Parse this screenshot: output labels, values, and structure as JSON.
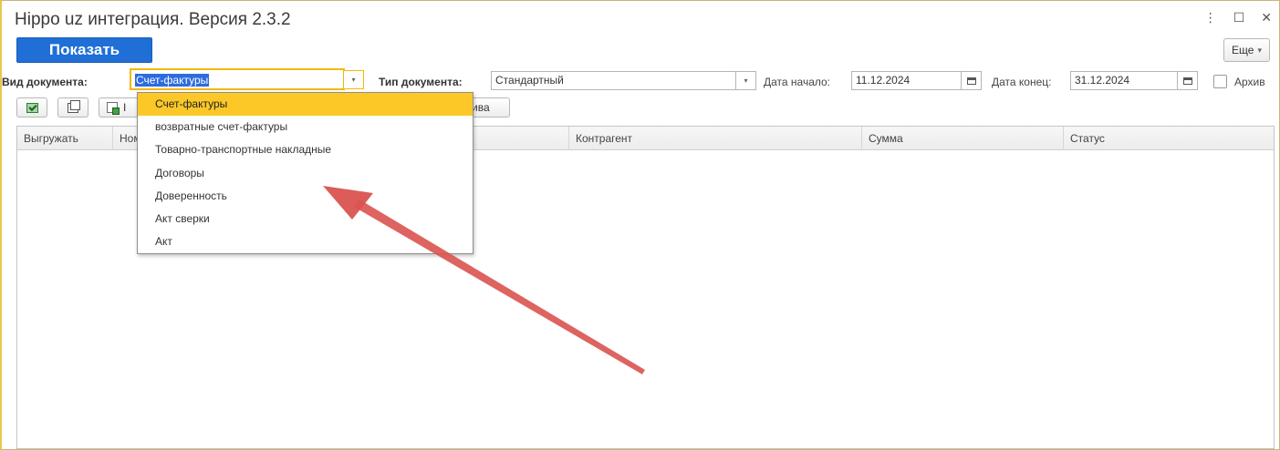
{
  "window": {
    "title": "Hippo uz интеграция. Версия 2.3.2",
    "controls": [
      "⋮",
      "☐",
      "✕"
    ]
  },
  "toolbar": {
    "show_label": "Показать",
    "more_label": "Еще",
    "more_arrow": "▾"
  },
  "filters": {
    "doc_kind_label": "Вид документа:",
    "doc_kind_value": "Счет-фактуры",
    "doc_type_label": "Тип документа:",
    "doc_type_value": "Стандартный",
    "date_start_label": "Дата начало:",
    "date_start_value": "11.12.2024",
    "date_end_label": "Дата конец:",
    "date_end_value": "31.12.2024",
    "archive_label": "Архив",
    "dropdown_arrow": "▾"
  },
  "action_bar": {
    "partial_left_label": "I",
    "partial_right_label": "ива"
  },
  "table": {
    "columns": [
      "Выгружать",
      "Ном",
      "Контрагент",
      "Сумма",
      "Статус"
    ]
  },
  "dropdown_options": [
    "Счет-фактуры",
    "возвратные счет-фактуры",
    "Товарно-транспортные накладные",
    "Договоры",
    "Доверенность",
    "Акт сверки",
    "Акт"
  ],
  "colors": {
    "accent_blue": "#1f6fd6",
    "highlight_yellow": "#fbc828",
    "arrow_red": "#d9534f"
  },
  "icons": {
    "calendar": "calendar-icon",
    "dropdown": "chevron-down-icon",
    "check_all": "check-all-icon",
    "copy": "copy-icon",
    "export_doc": "export-document-icon",
    "annotation_arrow": "annotation-arrow"
  }
}
